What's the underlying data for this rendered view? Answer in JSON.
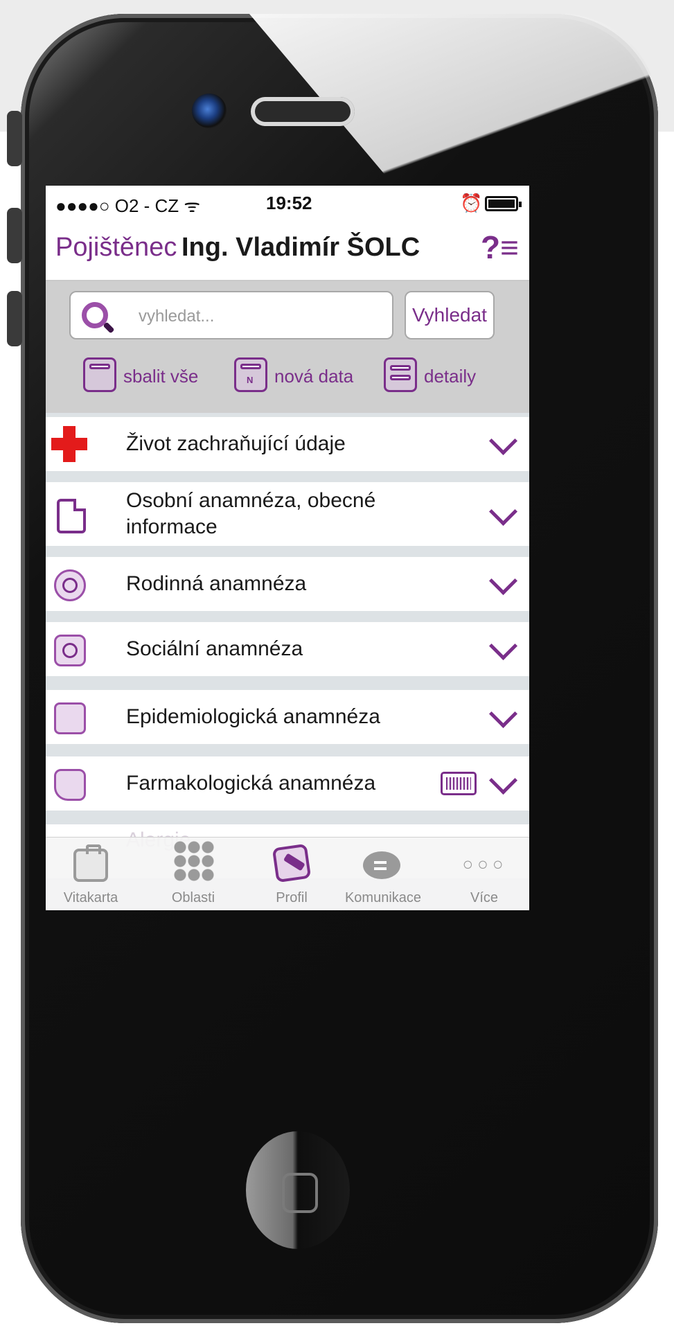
{
  "statusbar": {
    "carrier": "●●●●○ O2 - CZ ᯤ",
    "time": "19:52",
    "alarm_icon": "alarm-icon",
    "battery_icon": "battery-icon"
  },
  "header": {
    "label": "Pojištěnec",
    "name": "Ing. Vladimír ŠOLC",
    "help_icon": "?≡"
  },
  "search": {
    "placeholder": "vyhledat...",
    "button": "Vyhledat"
  },
  "tools": [
    {
      "label": "sbalit vše",
      "icon": "collapse-icon"
    },
    {
      "label": "nová data",
      "icon": "new-data-icon"
    },
    {
      "label": "detaily",
      "icon": "details-icon"
    }
  ],
  "sections": [
    {
      "label": "Život zachraňující údaje",
      "icon": "red-cross-icon"
    },
    {
      "label": "Osobní anamnéza, obecné informace",
      "icon": "document-icon"
    },
    {
      "label": "Rodinná anamnéza",
      "icon": "family-icon"
    },
    {
      "label": "Sociální anamnéza",
      "icon": "social-icon"
    },
    {
      "label": "Epidemiologická anamnéza",
      "icon": "epidemiology-icon"
    },
    {
      "label": "Farmakologická anamnéza",
      "icon": "pharmacology-icon",
      "extra_icon": "barcode-icon"
    },
    {
      "label": "Alergie",
      "icon": "allergy-icon"
    }
  ],
  "tabbar": {
    "tabs": [
      {
        "label": "Vitakarta",
        "icon": "id-card-icon",
        "active": false
      },
      {
        "label": "Oblasti",
        "icon": "grid-dots-icon",
        "active": false
      },
      {
        "label": "Profil",
        "icon": "profile-edit-icon",
        "active": true
      },
      {
        "label": "Komunikace",
        "icon": "chat-icon",
        "active": false
      },
      {
        "label": "Více",
        "icon": "more-icon",
        "active": false
      }
    ],
    "more_glyph": "○○○"
  },
  "colors": {
    "accent": "#7a2e8a",
    "alert_red": "#e31b1b",
    "panel_gray": "#cfcfcf"
  }
}
